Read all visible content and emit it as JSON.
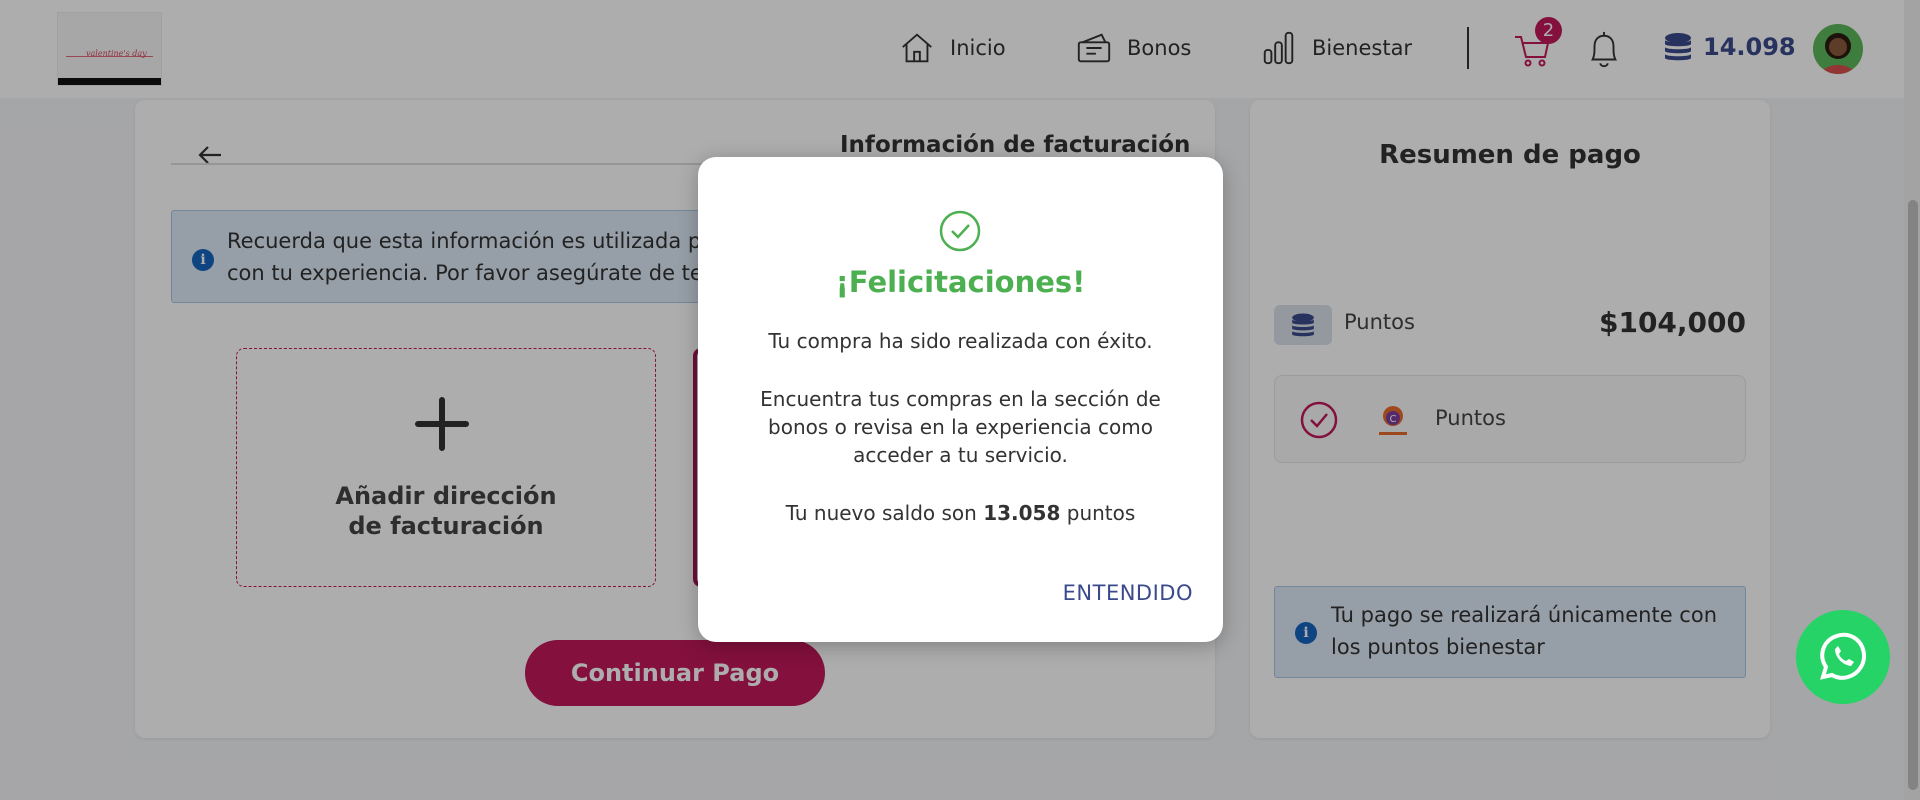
{
  "header": {
    "logo_script": "valentine's day",
    "nav": [
      {
        "label": "Inicio",
        "icon": "home-icon"
      },
      {
        "label": "Bonos",
        "icon": "voucher-icon"
      },
      {
        "label": "Bienestar",
        "icon": "bar-chart-icon"
      }
    ],
    "cart_count": "2",
    "points_balance": "14.098"
  },
  "billing": {
    "title": "Información de facturación",
    "info_text_line1": "Recuerda que esta información es utilizada para",
    "info_text_line2": "con tu experiencia. Por favor asegúrate de tener",
    "add_address_line1": "Añadir dirección",
    "add_address_line2": "de facturación",
    "continue_label": "Continuar Pago"
  },
  "summary": {
    "title": "Resumen de pago",
    "points_label": "Puntos",
    "points_amount": "$104,000",
    "method_label": "Puntos",
    "note_text": "Tu pago se realizará únicamente con los puntos bienestar"
  },
  "modal": {
    "title": "¡Felicitaciones!",
    "line1": "Tu compra ha sido realizada con éxito.",
    "line2": "Encuentra tus compras en la sección de bonos o revisa en la experiencia como acceder a tu servicio.",
    "balance_prefix": "Tu nuevo saldo son ",
    "balance_value": "13.058",
    "balance_suffix": " puntos",
    "button_label": "ENTENDIDO"
  },
  "colors": {
    "accent": "#c2185b",
    "success": "#4caf50",
    "link": "#3b4a8c",
    "whatsapp": "#25d366"
  }
}
